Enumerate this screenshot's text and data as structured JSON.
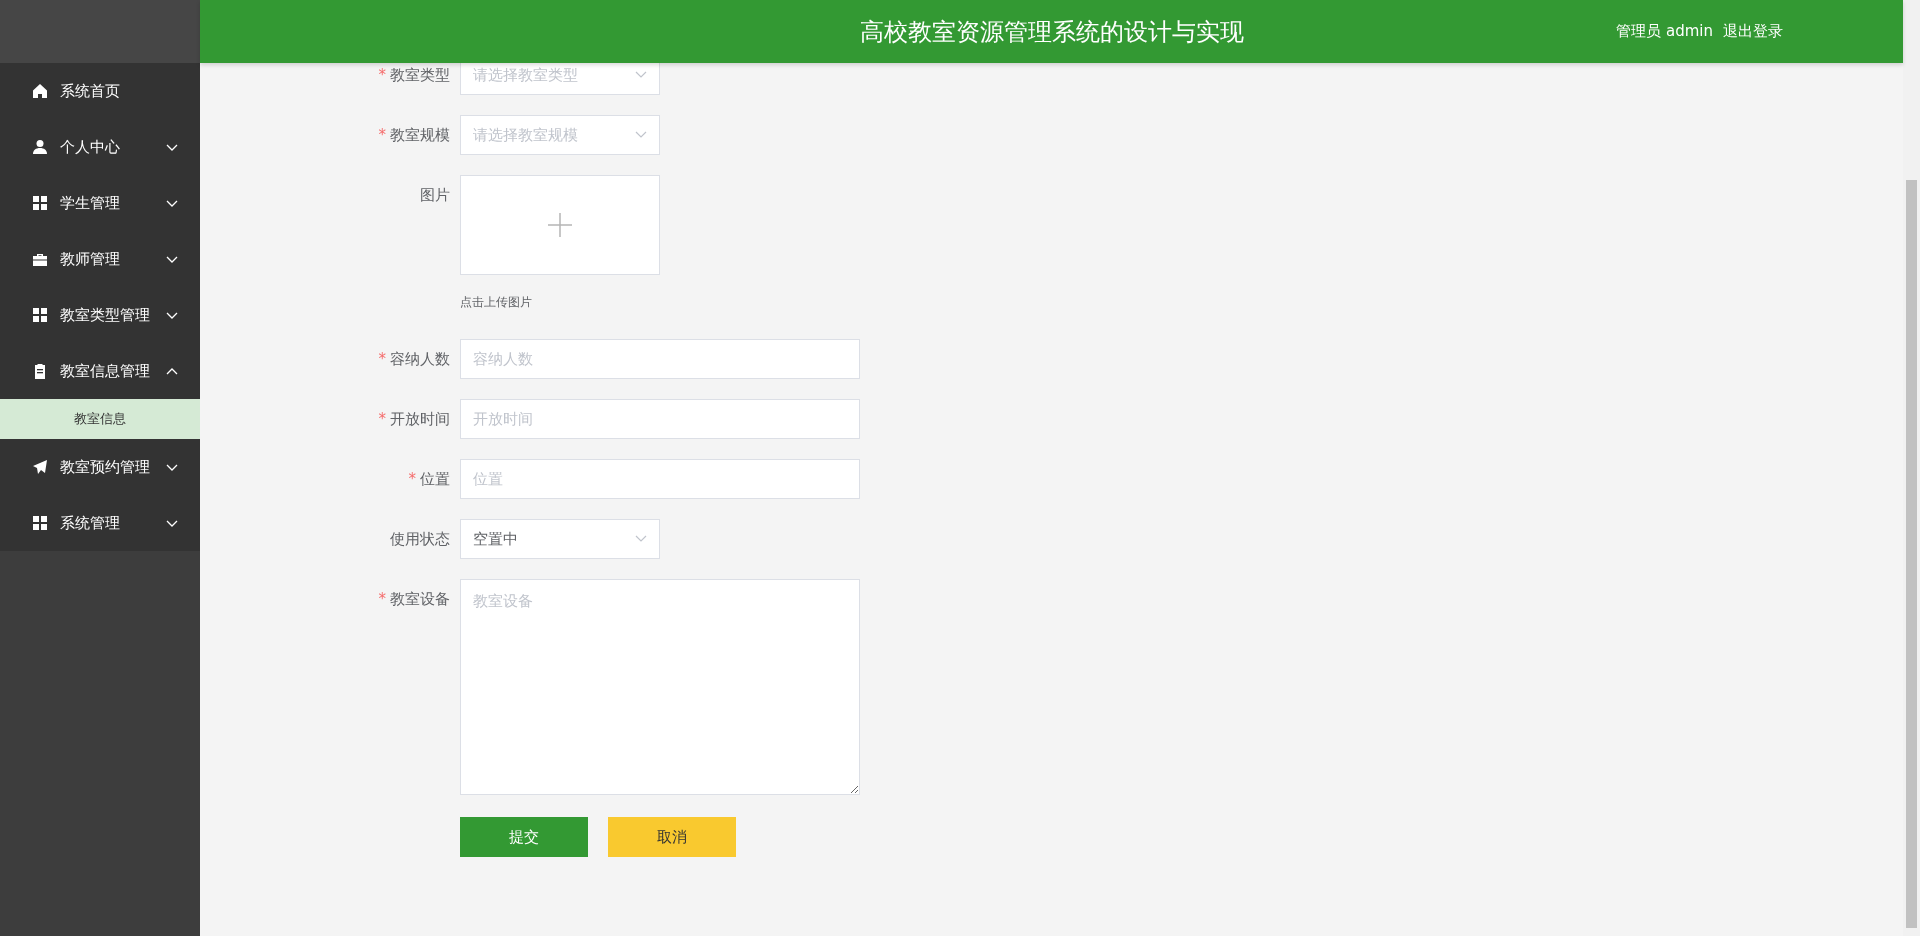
{
  "header": {
    "title": "高校教室资源管理系统的设计与实现",
    "user": "管理员 admin",
    "logout": "退出登录"
  },
  "sidebar": {
    "items": [
      {
        "label": "系统首页",
        "kind": "link"
      },
      {
        "label": "个人中心",
        "kind": "group",
        "expanded": false
      },
      {
        "label": "学生管理",
        "kind": "group",
        "expanded": false
      },
      {
        "label": "教师管理",
        "kind": "group",
        "expanded": false
      },
      {
        "label": "教室类型管理",
        "kind": "group",
        "expanded": false
      },
      {
        "label": "教室信息管理",
        "kind": "group",
        "expanded": true,
        "children": [
          {
            "label": "教室信息",
            "selected": true
          }
        ]
      },
      {
        "label": "教室预约管理",
        "kind": "group",
        "expanded": false
      },
      {
        "label": "系统管理",
        "kind": "group",
        "expanded": false
      }
    ]
  },
  "form": {
    "fields": [
      {
        "label": "教室类型",
        "kind": "select",
        "required_mark": "*",
        "placeholder": "请选择教室类型"
      },
      {
        "label": "教室规模",
        "kind": "select",
        "required_mark": "*",
        "placeholder": "请选择教室规模"
      },
      {
        "label": "图片",
        "kind": "upload",
        "hint": "点击上传图片"
      },
      {
        "label": "容纳人数",
        "kind": "input",
        "required_mark": "*",
        "placeholder": "容纳人数"
      },
      {
        "label": "开放时间",
        "kind": "input",
        "required_mark": "*",
        "placeholder": "开放时间"
      },
      {
        "label": "位置",
        "kind": "input",
        "required_mark": "*",
        "placeholder": "位置"
      },
      {
        "label": "使用状态",
        "kind": "select",
        "value": "空置中"
      },
      {
        "label": "教室设备",
        "kind": "textarea",
        "required_mark": "*",
        "placeholder": "教室设备"
      }
    ],
    "buttons": [
      {
        "label": "提交",
        "kind": "primary"
      },
      {
        "label": "取消",
        "kind": "warning"
      }
    ]
  }
}
